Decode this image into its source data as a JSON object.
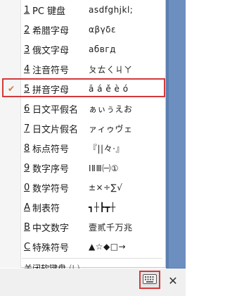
{
  "menu": {
    "items": [
      {
        "num": "1",
        "name": "PC 键盘",
        "sample": "asdfghjkl;",
        "checked": false
      },
      {
        "num": "2",
        "name": "希腊字母",
        "sample": "αβγδε",
        "checked": false
      },
      {
        "num": "3",
        "name": "俄文字母",
        "sample": "абвгд",
        "checked": false
      },
      {
        "num": "4",
        "name": "注音符号",
        "sample": "ㄆㄊㄑㄐㄚ",
        "checked": false
      },
      {
        "num": "5",
        "name": "拼音字母",
        "sample": "ā á ě è ó",
        "checked": true
      },
      {
        "num": "6",
        "name": "日文平假名",
        "sample": "ぁぃぅえお",
        "checked": false
      },
      {
        "num": "7",
        "name": "日文片假名",
        "sample": "ァィゥヴェ",
        "checked": false
      },
      {
        "num": "8",
        "name": "标点符号",
        "sample": "『||々·』",
        "checked": false
      },
      {
        "num": "9",
        "name": "数字序号",
        "sample": "ⅠⅡⅢ㈠①",
        "checked": false
      },
      {
        "num": "0",
        "name": "数学符号",
        "sample": "±×÷∑√",
        "checked": false
      },
      {
        "num": "A",
        "name": "制表符",
        "sample": "┓┼┣┳┼",
        "checked": false
      },
      {
        "num": "B",
        "name": "中文数字",
        "sample": "壹贰千万兆",
        "checked": false
      },
      {
        "num": "C",
        "name": "特殊符号",
        "sample": "▲☆◆□→",
        "checked": false
      }
    ],
    "close_label": "关闭软键盘",
    "close_shortcut": "(L)"
  },
  "taskbar": {
    "keyboard_icon": "keyboard-icon",
    "close_glyph": "✕"
  },
  "colors": {
    "highlight": "#d33a3a",
    "check": "#d4783a",
    "background_blue": "#5b7fb2"
  }
}
